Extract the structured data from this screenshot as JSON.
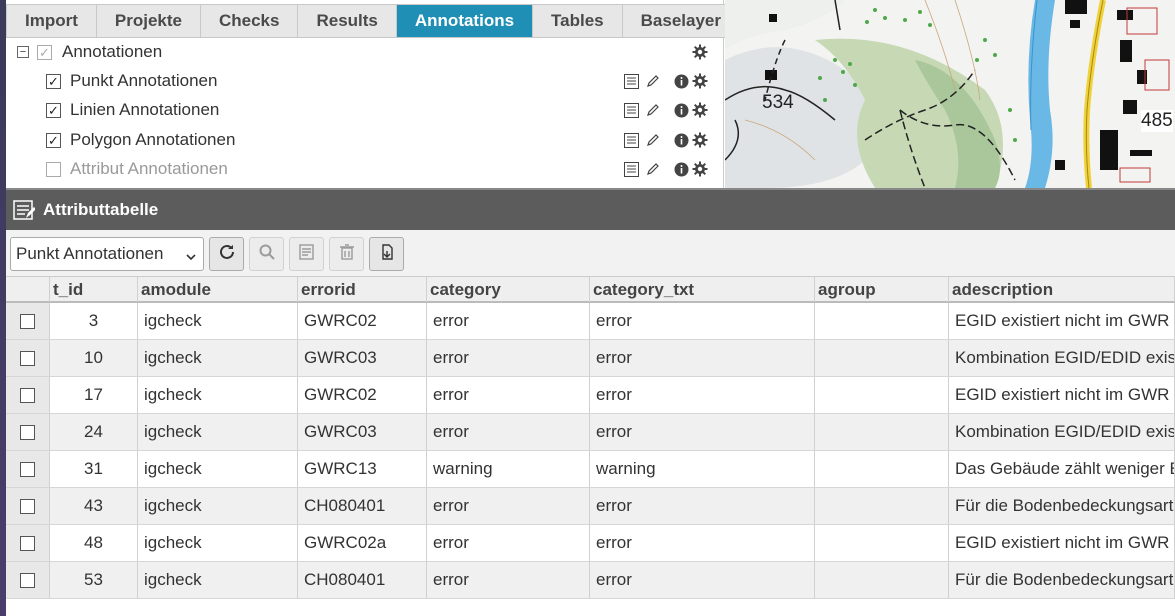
{
  "tabs": [
    {
      "label": "Import",
      "active": false
    },
    {
      "label": "Projekte",
      "active": false
    },
    {
      "label": "Checks",
      "active": false
    },
    {
      "label": "Results",
      "active": false
    },
    {
      "label": "Annotations",
      "active": true
    },
    {
      "label": "Tables",
      "active": false
    },
    {
      "label": "Baselayer",
      "active": false
    }
  ],
  "tree": {
    "root_label": "Annotationen",
    "items": [
      {
        "label": "Punkt Annotationen",
        "checked": true
      },
      {
        "label": "Linien Annotationen",
        "checked": true
      },
      {
        "label": "Polygon Annotationen",
        "checked": true
      },
      {
        "label": "Attribut Annotationen",
        "checked": false
      }
    ]
  },
  "map": {
    "labels": [
      "534",
      "485"
    ]
  },
  "attribute_table": {
    "title": "Attributtabelle",
    "layer_select": "Punkt Annotationen",
    "columns": [
      "t_id",
      "amodule",
      "errorid",
      "category",
      "category_txt",
      "agroup",
      "adescription"
    ],
    "rows": [
      {
        "t_id": "3",
        "amodule": "igcheck",
        "errorid": "GWRC02",
        "category": "error",
        "category_txt": "error",
        "agroup": "",
        "adescription": "EGID existiert nicht im GWR"
      },
      {
        "t_id": "10",
        "amodule": "igcheck",
        "errorid": "GWRC03",
        "category": "error",
        "category_txt": "error",
        "agroup": "",
        "adescription": "Kombination EGID/EDID exis"
      },
      {
        "t_id": "17",
        "amodule": "igcheck",
        "errorid": "GWRC02",
        "category": "error",
        "category_txt": "error",
        "agroup": "",
        "adescription": "EGID existiert nicht im GWR"
      },
      {
        "t_id": "24",
        "amodule": "igcheck",
        "errorid": "GWRC03",
        "category": "error",
        "category_txt": "error",
        "agroup": "",
        "adescription": "Kombination EGID/EDID exis"
      },
      {
        "t_id": "31",
        "amodule": "igcheck",
        "errorid": "GWRC13",
        "category": "warning",
        "category_txt": "warning",
        "agroup": "",
        "adescription": "Das Gebäude zählt weniger E"
      },
      {
        "t_id": "43",
        "amodule": "igcheck",
        "errorid": "CH080401",
        "category": "error",
        "category_txt": "error",
        "agroup": "",
        "adescription": "Für die Bodenbedeckungsart"
      },
      {
        "t_id": "48",
        "amodule": "igcheck",
        "errorid": "GWRC02a",
        "category": "error",
        "category_txt": "error",
        "agroup": "",
        "adescription": "EGID existiert nicht im GWR"
      },
      {
        "t_id": "53",
        "amodule": "igcheck",
        "errorid": "CH080401",
        "category": "error",
        "category_txt": "error",
        "agroup": "",
        "adescription": "Für die Bodenbedeckungsart"
      }
    ]
  },
  "colors": {
    "active_tab": "#1f8fb5",
    "header_bar": "#5c5c5c"
  },
  "icons": {
    "row_actions": [
      "attribute-table-icon",
      "edit-icon",
      "info-icon",
      "settings-gear-icon"
    ],
    "toolbar": [
      "refresh-icon",
      "search-icon",
      "edit-form-icon",
      "trash-icon",
      "export-icon"
    ]
  }
}
